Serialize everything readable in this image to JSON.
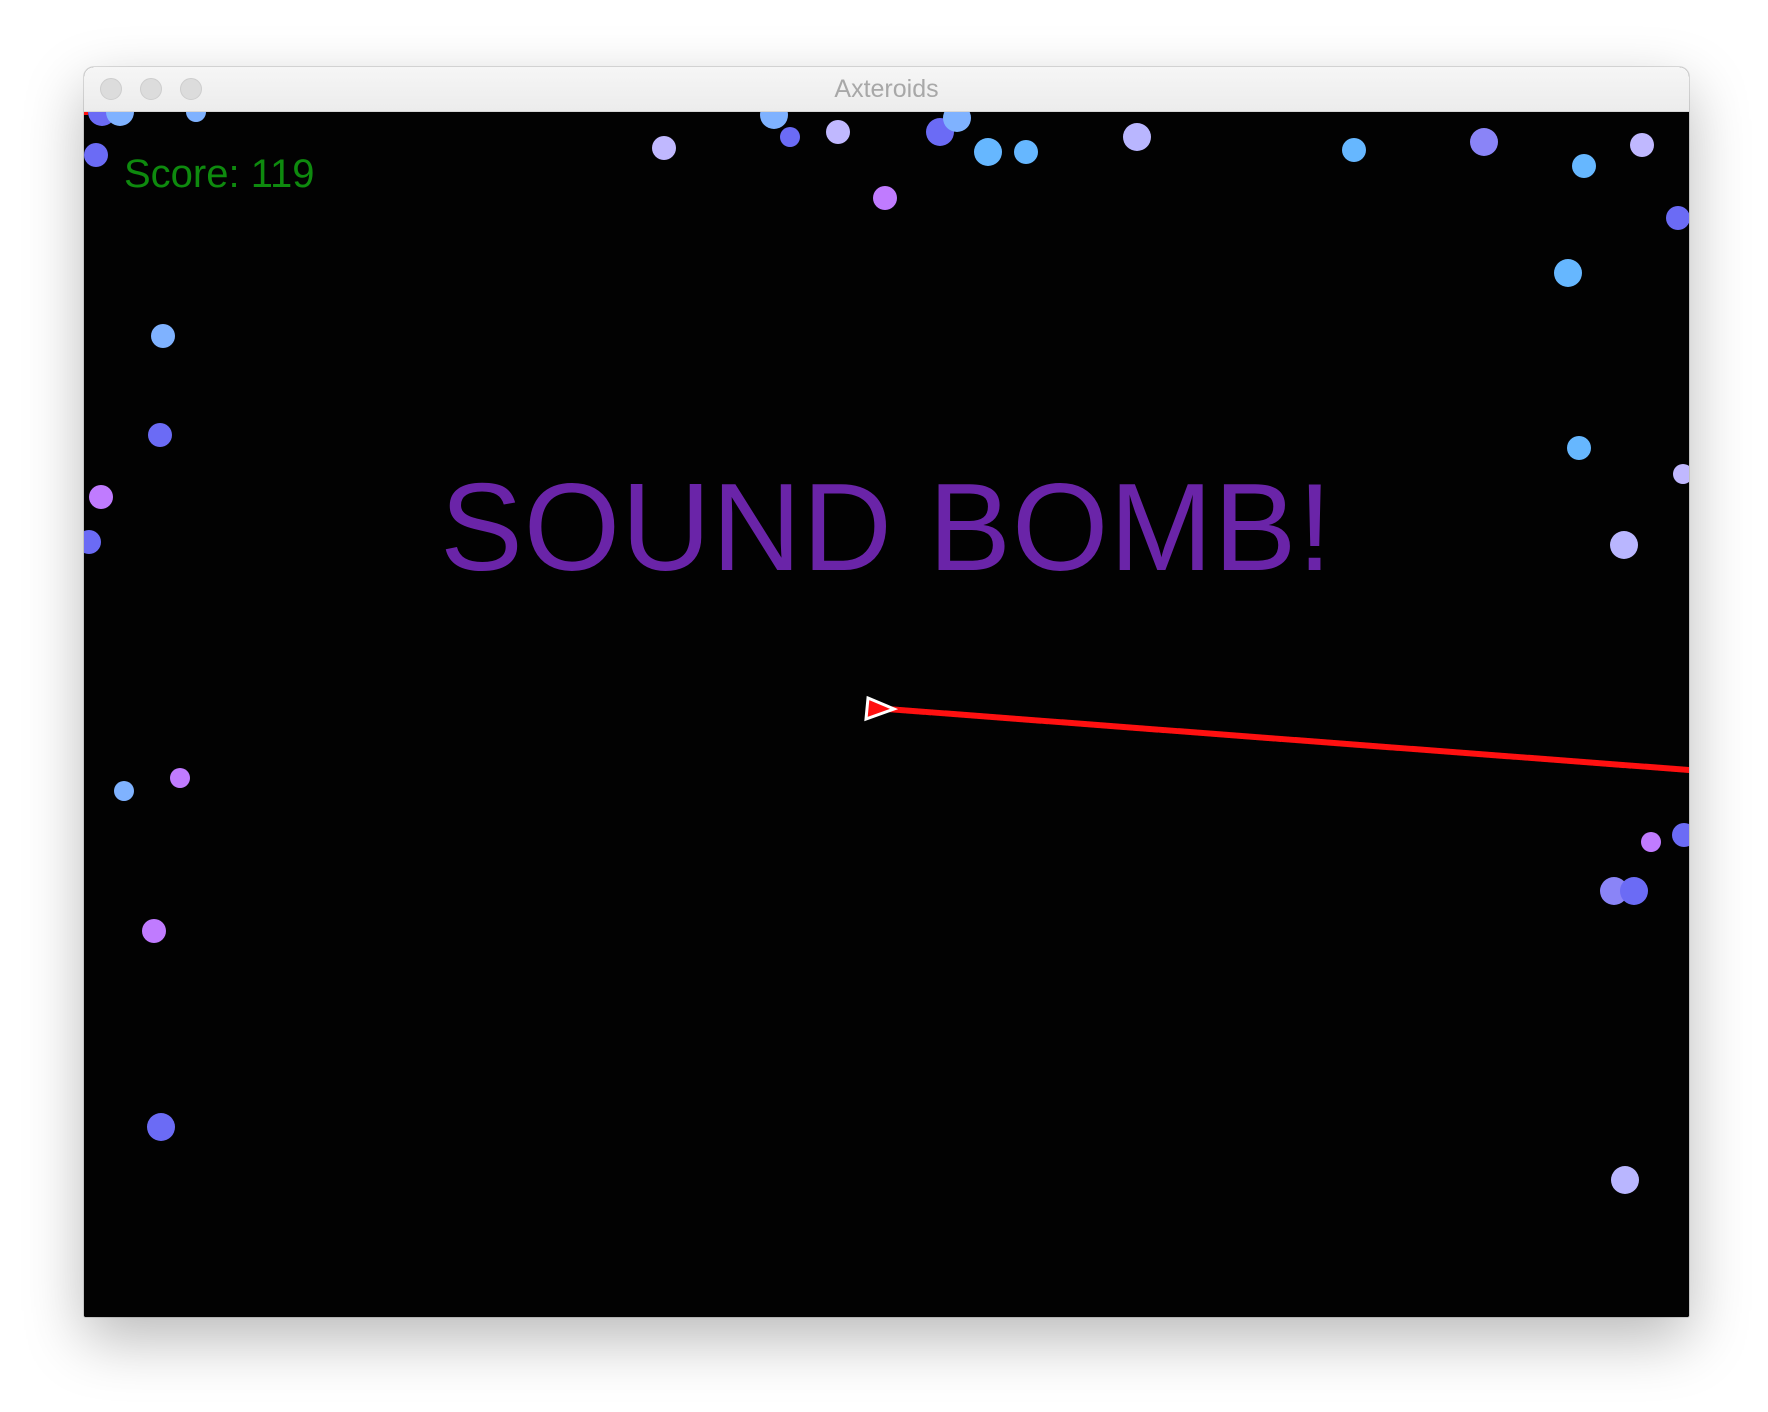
{
  "window": {
    "title": "Axteroids"
  },
  "game": {
    "score_label": "Score: 119",
    "banner": "SOUND BOMB!",
    "colors": {
      "background": "#020202",
      "score": "#0e8a0e",
      "banner": "#6a24a8",
      "laser": "#ff1010",
      "ship_outline": "#ffffff",
      "ship_fill": "#ff1010"
    },
    "asteroid_palette": [
      "#6b6bf5",
      "#7fb2ff",
      "#b49cff",
      "#c07bff",
      "#8a84f7",
      "#c0b8ff",
      "#66b7ff",
      "#9f74f5",
      "#b9b6ff"
    ]
  }
}
